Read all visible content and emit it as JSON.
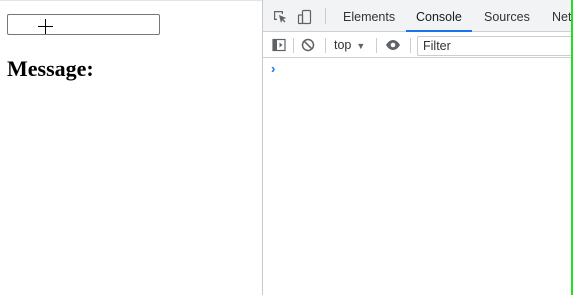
{
  "page": {
    "heading": "Message:",
    "input_value": ""
  },
  "devtools": {
    "tabs": [
      {
        "label": "Elements",
        "active": false
      },
      {
        "label": "Console",
        "active": true
      },
      {
        "label": "Sources",
        "active": false
      },
      {
        "label": "Net",
        "active": false
      }
    ],
    "toolbar": {
      "context": "top",
      "filter_placeholder": "Filter"
    },
    "console_prompt": "›"
  },
  "icons": {
    "inspect": "inspect-element-icon",
    "device": "device-toolbar-icon",
    "sidebar": "show-sidebar-icon",
    "clear": "clear-console-icon",
    "eye": "live-expression-icon",
    "cursor": "crosshair-cursor-icon"
  },
  "colors": {
    "accent": "#1a73e8",
    "edge_line": "#22dd22"
  }
}
